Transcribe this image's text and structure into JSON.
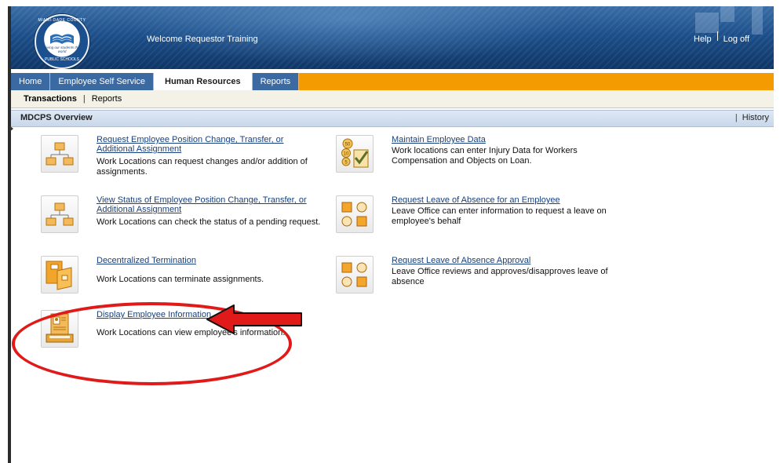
{
  "header": {
    "logo": {
      "ring_text": "MIAMI-DADE COUNTY",
      "motto": "giving our students the world",
      "bottom_text": "PUBLIC SCHOOLS"
    },
    "welcome_text": "Welcome Requestor Training",
    "help_label": "Help",
    "logoff_label": "Log off"
  },
  "tabs": [
    {
      "label": "Home",
      "active": false
    },
    {
      "label": "Employee Self Service",
      "active": false
    },
    {
      "label": "Human Resources",
      "active": true
    },
    {
      "label": "Reports",
      "active": false
    }
  ],
  "subnav": {
    "items": [
      "Transactions",
      "Reports"
    ],
    "active": "Transactions"
  },
  "page": {
    "title": "MDCPS Overview",
    "history_label": "History"
  },
  "items": [
    {
      "icon": "org-chart-icon",
      "link": "Request Employee Position Change, Transfer, or Additional Assignment",
      "description": "Work Locations can request changes and/or addition of assignments."
    },
    {
      "icon": "org-chart-icon",
      "link": "View Status of Employee Position Change, Transfer, or Additional Assignment",
      "description": "Work Locations can check the status of a pending request."
    },
    {
      "icon": "folders-icon",
      "link": "Decentralized Termination",
      "description": "Work Locations can terminate assignments."
    },
    {
      "icon": "employee-info-icon",
      "link": "Display Employee Information",
      "description": "Work Locations can view employee's information."
    },
    {
      "icon": "coins-checklist-icon",
      "link": "Maintain Employee Data",
      "description": "Work locations can enter Injury Data for Workers Compensation and Objects on Loan."
    },
    {
      "icon": "shapes-icon",
      "link": "Request Leave of Absence for an Employee",
      "description": "Leave Office can enter information to request a leave on employee's behalf"
    },
    {
      "icon": "shapes-icon",
      "link": "Request Leave of Absence Approval",
      "description": "Leave Office reviews and approves/disapproves leave of absence"
    }
  ],
  "colors": {
    "header": "#1d4f8a",
    "tab_bar": "#f39b00",
    "tab": "#3b6aa3",
    "link": "#17407e",
    "annotation": "#e01919"
  }
}
